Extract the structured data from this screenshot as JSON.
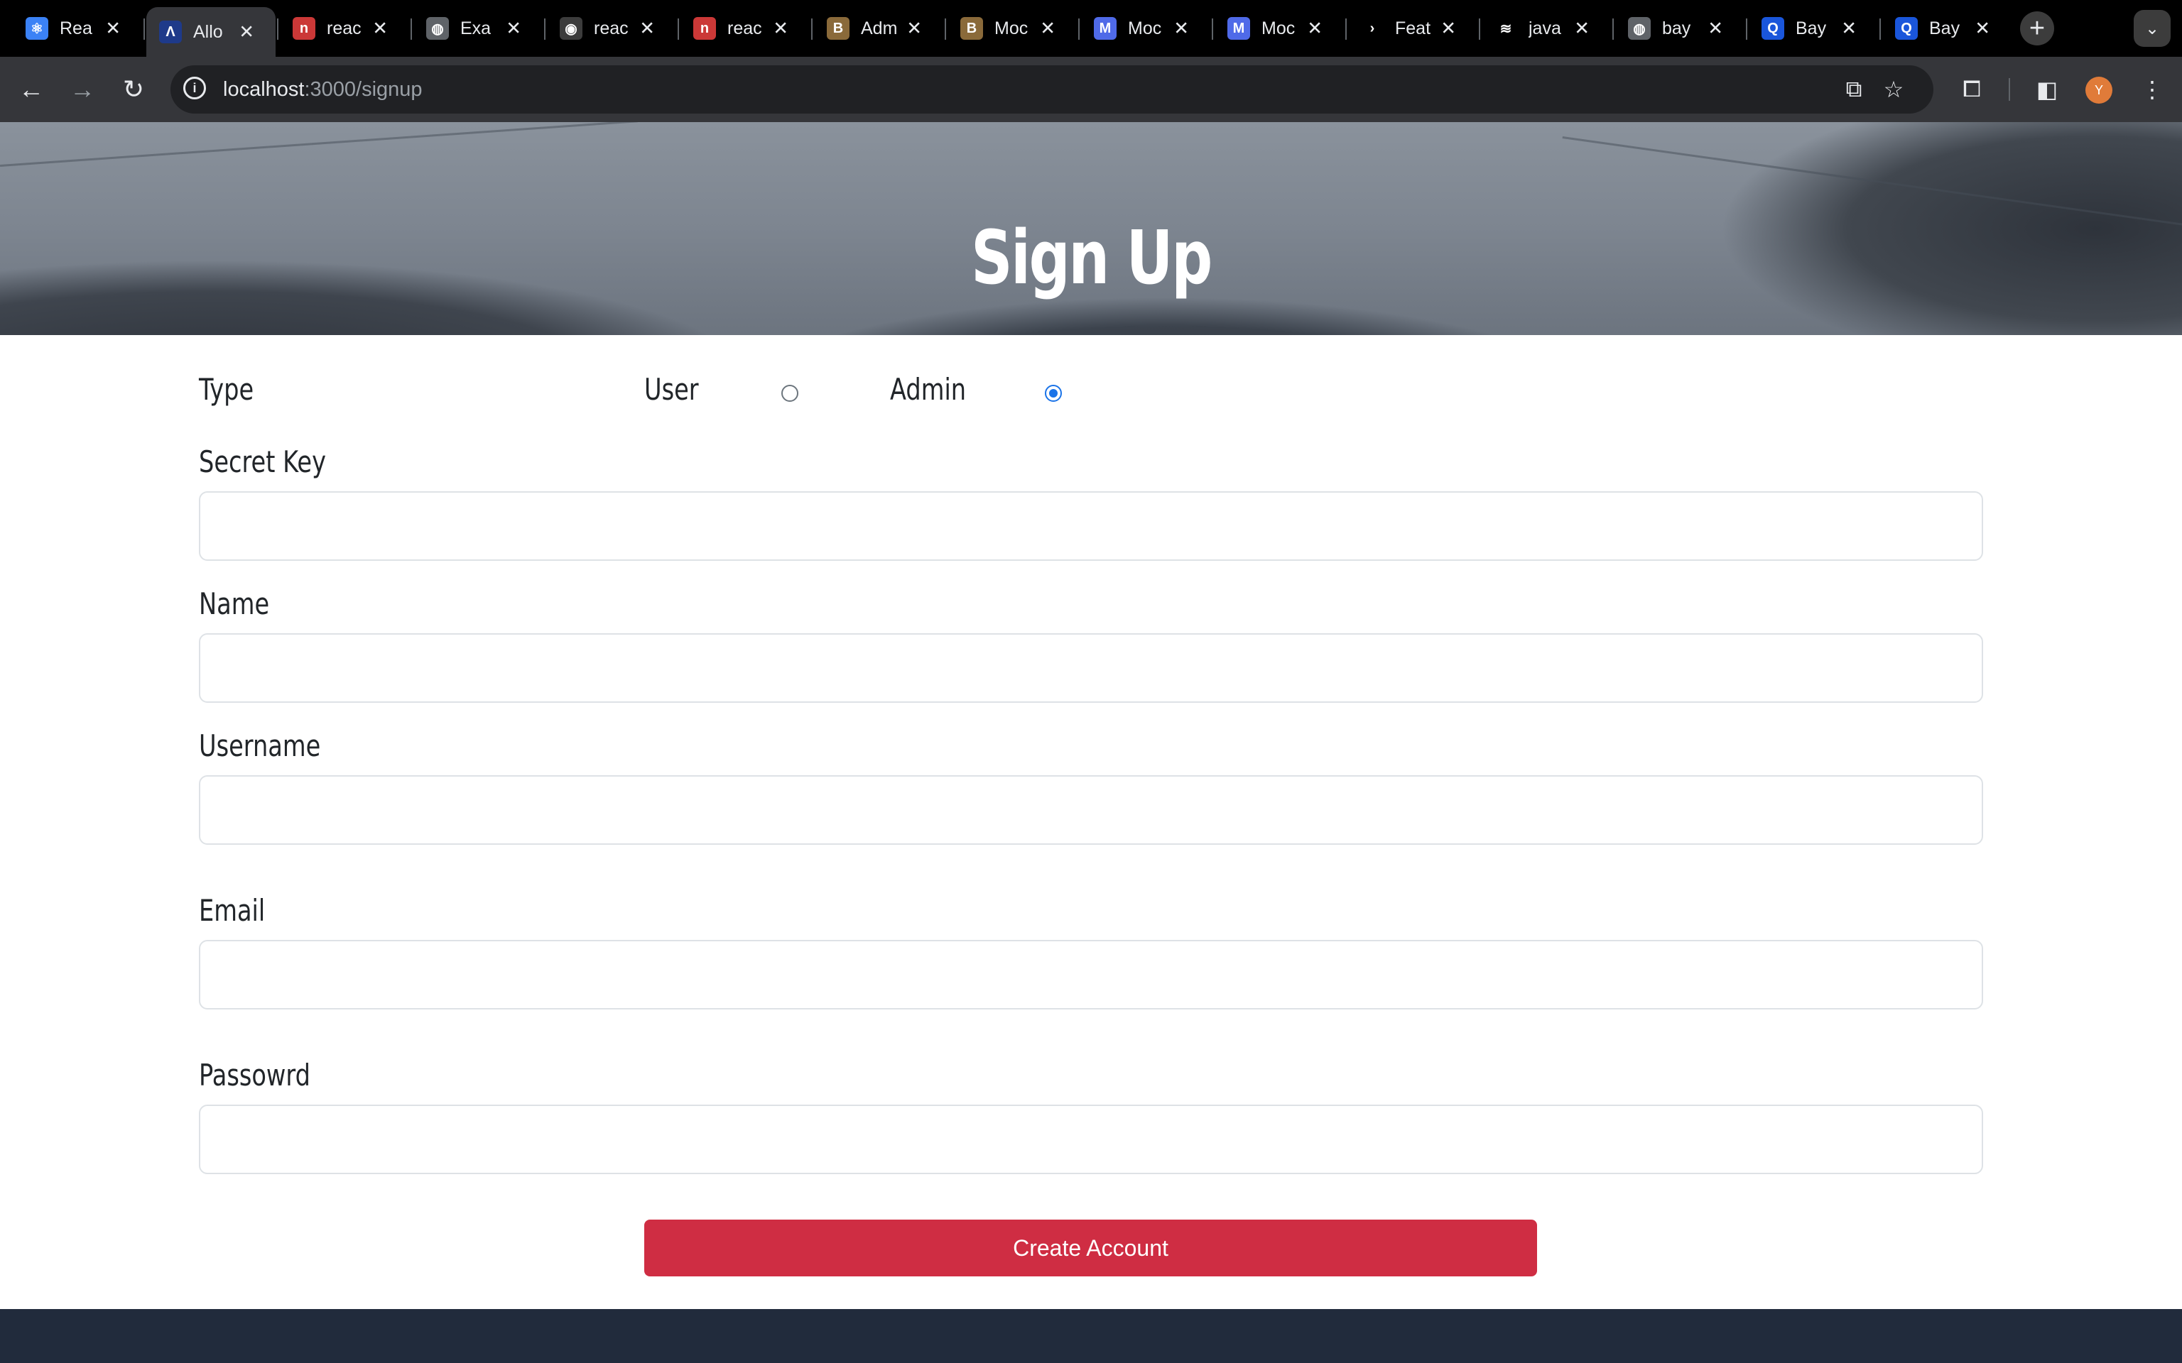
{
  "browser": {
    "tabs": [
      {
        "label": "Rea",
        "favicon": "react-icon",
        "color": "#3b82f6",
        "glyph": "⚛"
      },
      {
        "label": "Allo",
        "favicon": "a-logo-icon",
        "color": "#1e3a8a",
        "glyph": "Λ",
        "active": true
      },
      {
        "label": "reac",
        "favicon": "npm-icon",
        "color": "#cb3837",
        "glyph": "n"
      },
      {
        "label": "Exa",
        "favicon": "globe-icon",
        "color": "#5f6368",
        "glyph": "◍"
      },
      {
        "label": "reac",
        "favicon": "github-icon",
        "color": "#3c3c3c",
        "glyph": "◉"
      },
      {
        "label": "reac",
        "favicon": "npm-icon",
        "color": "#cb3837",
        "glyph": "n"
      },
      {
        "label": "Adm",
        "favicon": "bootstrap-icon",
        "color": "#8a6a3a",
        "glyph": "B"
      },
      {
        "label": "Moc",
        "favicon": "bootstrap-icon",
        "color": "#8a6a3a",
        "glyph": "B"
      },
      {
        "label": "Moc",
        "favicon": "material-icon",
        "color": "#4f6ae8",
        "glyph": "M"
      },
      {
        "label": "Moc",
        "favicon": "material-icon",
        "color": "#4f6ae8",
        "glyph": "M"
      },
      {
        "label": "Feat",
        "favicon": "arrow-icon",
        "color": "#000000",
        "glyph": "›"
      },
      {
        "label": "java",
        "favicon": "stackoverflow-icon",
        "color": "#000000",
        "glyph": "≋"
      },
      {
        "label": "bay",
        "favicon": "globe-icon",
        "color": "#5f6368",
        "glyph": "◍"
      },
      {
        "label": "Bay",
        "favicon": "q-icon",
        "color": "#1a56db",
        "glyph": "Q"
      },
      {
        "label": "Bay",
        "favicon": "q-icon",
        "color": "#1a56db",
        "glyph": "Q"
      }
    ],
    "url_host": "localhost",
    "url_path": ":3000/signup",
    "avatar_letter": "Y",
    "avatar_color": "#e07b39"
  },
  "page": {
    "title": "Sign Up",
    "type_label": "Type",
    "radio_user_label": "User",
    "radio_admin_label": "Admin",
    "selected_type": "Admin",
    "secret_key_label": "Secret Key",
    "secret_key_value": "",
    "name_label": "Name",
    "name_value": "",
    "username_label": "Username",
    "username_value": "",
    "email_label": "Email",
    "email_value": "",
    "password_label": "Passowrd",
    "password_value": "",
    "submit_label": "Create Account",
    "accent_color": "#cf2d43",
    "footer_color": "#212b3c"
  }
}
